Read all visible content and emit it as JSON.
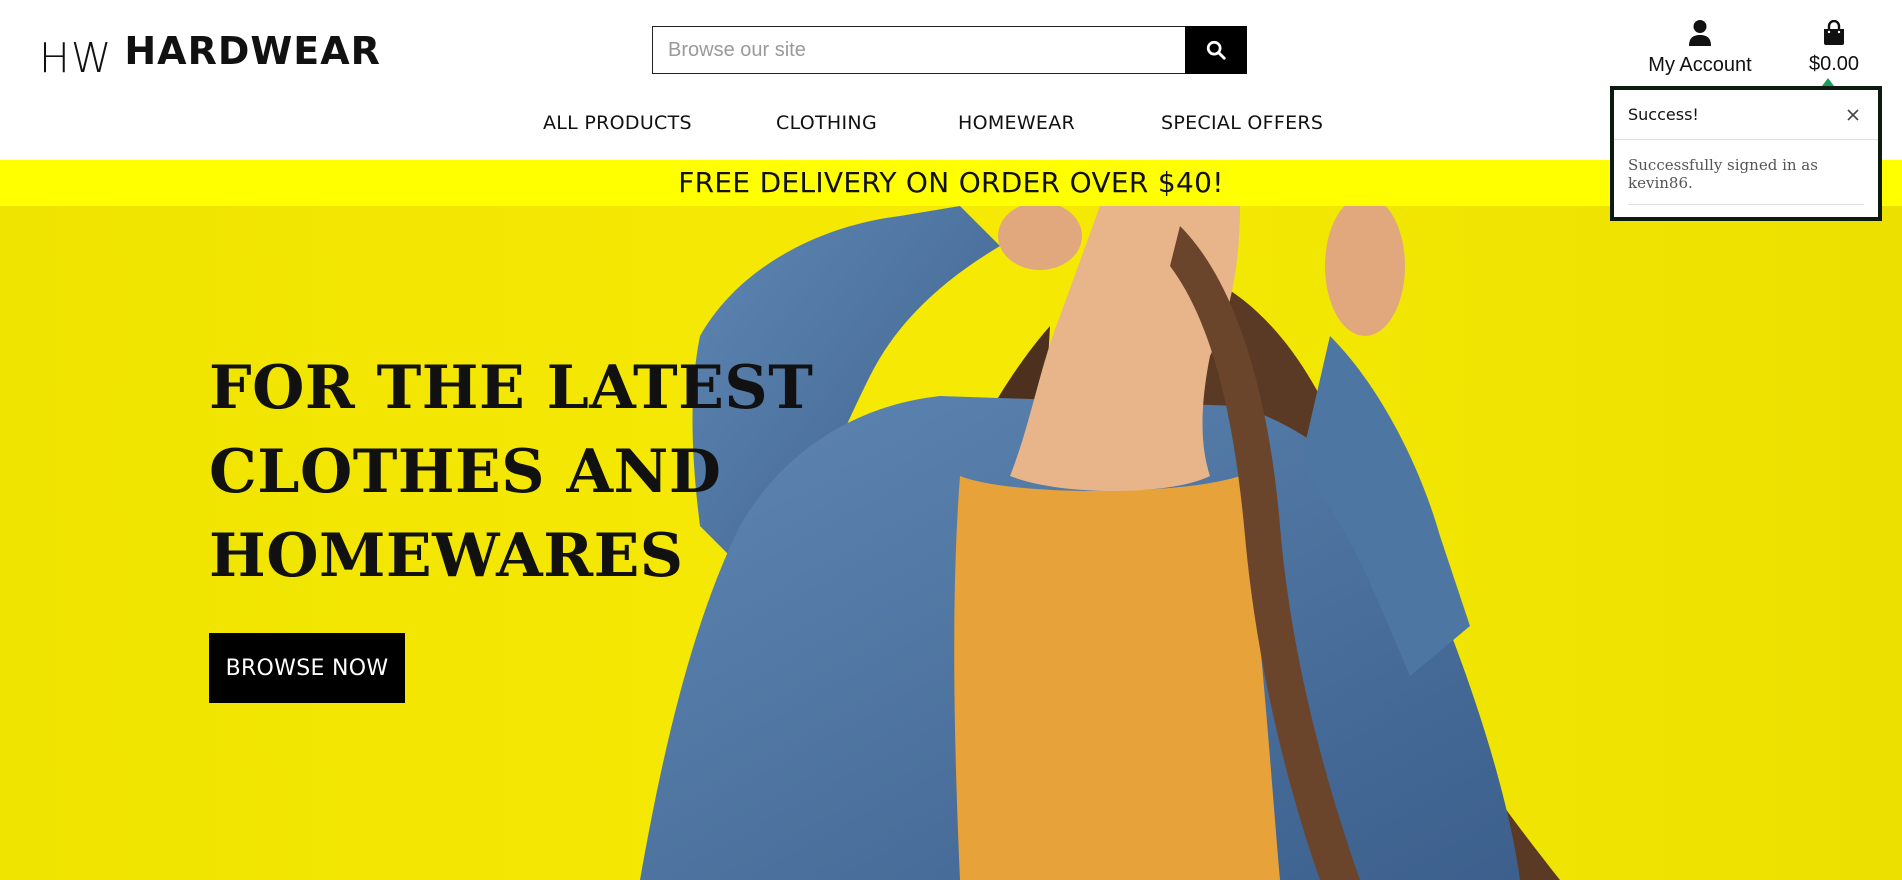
{
  "brand": {
    "mark": "HW",
    "name": "HARDWEAR"
  },
  "search": {
    "placeholder": "Browse our site",
    "value": ""
  },
  "account": {
    "label": "My Account"
  },
  "bag": {
    "total": "$0.00"
  },
  "nav": [
    {
      "label": "ALL PRODUCTS"
    },
    {
      "label": "CLOTHING"
    },
    {
      "label": "HOMEWEAR"
    },
    {
      "label": "SPECIAL OFFERS"
    }
  ],
  "banner": {
    "text": "FREE DELIVERY ON ORDER OVER $40!"
  },
  "hero": {
    "lines": [
      "FOR THE LATEST",
      "CLOTHES AND",
      "HOMEWARES"
    ],
    "cta": "BROWSE NOW"
  },
  "toast": {
    "title": "Success!",
    "message": "Successfully signed in as kevin86."
  },
  "colors": {
    "banner_yellow": "#ffff00",
    "hero_yellow": "#f3e800",
    "black": "#000000",
    "toast_arrow": "#1aa05a"
  },
  "icons": [
    "search-icon",
    "user-icon",
    "shopping-bag-icon",
    "close-icon"
  ]
}
